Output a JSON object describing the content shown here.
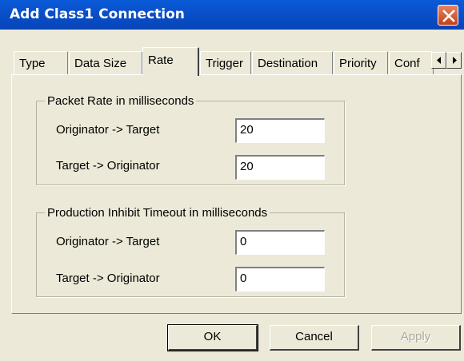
{
  "window": {
    "title": "Add Class1 Connection",
    "close_icon": "close-x"
  },
  "tabs": [
    {
      "label": "Type",
      "active": false
    },
    {
      "label": "Data Size",
      "active": false
    },
    {
      "label": "Rate",
      "active": true
    },
    {
      "label": "Trigger",
      "active": false
    },
    {
      "label": "Destination",
      "active": false
    },
    {
      "label": "Priority",
      "active": false
    },
    {
      "label": "Conf",
      "active": false
    }
  ],
  "tab_scroll": {
    "left_icon": "arrow-left",
    "right_icon": "arrow-right"
  },
  "packet_rate": {
    "legend": "Packet Rate in milliseconds",
    "rows": [
      {
        "label": "Originator -> Target",
        "value": "20"
      },
      {
        "label": "Target -> Originator",
        "value": "20"
      }
    ]
  },
  "inhibit_timeout": {
    "legend": "Production Inhibit Timeout in milliseconds",
    "rows": [
      {
        "label": "Originator -> Target",
        "value": "0"
      },
      {
        "label": "Target -> Originator",
        "value": "0"
      }
    ]
  },
  "buttons": {
    "ok": "OK",
    "cancel": "Cancel",
    "apply": "Apply"
  }
}
